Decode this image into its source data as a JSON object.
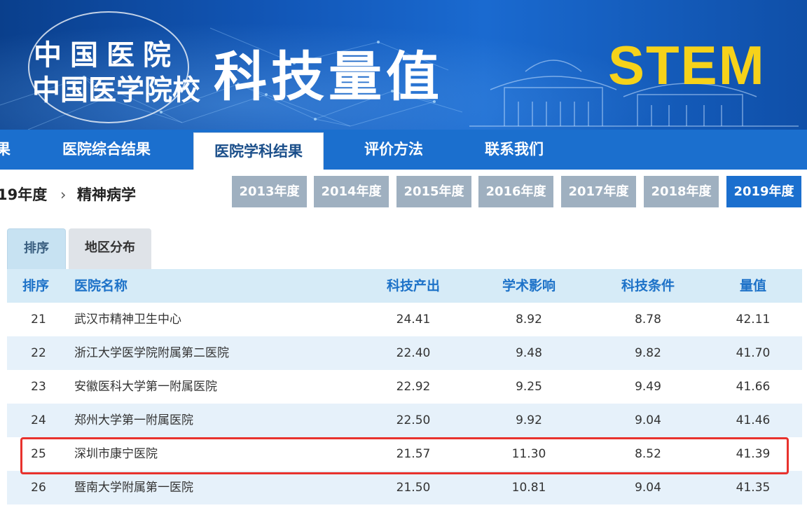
{
  "banner": {
    "org_line1": "中国医院",
    "org_line2": "中国医学院校",
    "title": "科技量值",
    "stem": "STEM"
  },
  "nav": {
    "partial_left": "果",
    "items": [
      "医院综合结果",
      "医院学科结果",
      "评价方法",
      "联系我们"
    ],
    "active_index": 1
  },
  "breadcrumb": {
    "year": "19年度",
    "arrow": "›",
    "department": "精神病学"
  },
  "years": {
    "items": [
      "2013年度",
      "2014年度",
      "2015年度",
      "2016年度",
      "2017年度",
      "2018年度",
      "2019年度"
    ],
    "active": "2019年度"
  },
  "subtabs": {
    "rank": "排序",
    "region": "地区分布"
  },
  "table": {
    "headers": {
      "rank": "排序",
      "name": "医院名称",
      "output": "科技产出",
      "academic": "学术影响",
      "conditions": "科技条件",
      "value": "量值"
    },
    "rows": [
      {
        "rank": "21",
        "name": "武汉市精神卫生中心",
        "output": "24.41",
        "academic": "8.92",
        "conditions": "8.78",
        "value": "42.11"
      },
      {
        "rank": "22",
        "name": "浙江大学医学院附属第二医院",
        "output": "22.40",
        "academic": "9.48",
        "conditions": "9.82",
        "value": "41.70"
      },
      {
        "rank": "23",
        "name": "安徽医科大学第一附属医院",
        "output": "22.92",
        "academic": "9.25",
        "conditions": "9.49",
        "value": "41.66"
      },
      {
        "rank": "24",
        "name": "郑州大学第一附属医院",
        "output": "22.50",
        "academic": "9.92",
        "conditions": "9.04",
        "value": "41.46"
      },
      {
        "rank": "25",
        "name": "深圳市康宁医院",
        "output": "21.57",
        "academic": "11.30",
        "conditions": "8.52",
        "value": "41.39"
      },
      {
        "rank": "26",
        "name": "暨南大学附属第一医院",
        "output": "21.50",
        "academic": "10.81",
        "conditions": "9.04",
        "value": "41.35"
      }
    ],
    "highlighted_rank": "25"
  },
  "colors": {
    "nav_blue": "#1b6fce",
    "header_text_blue": "#1d72c8",
    "highlight_red": "#e8322d",
    "stem_yellow": "#f6d21a"
  }
}
